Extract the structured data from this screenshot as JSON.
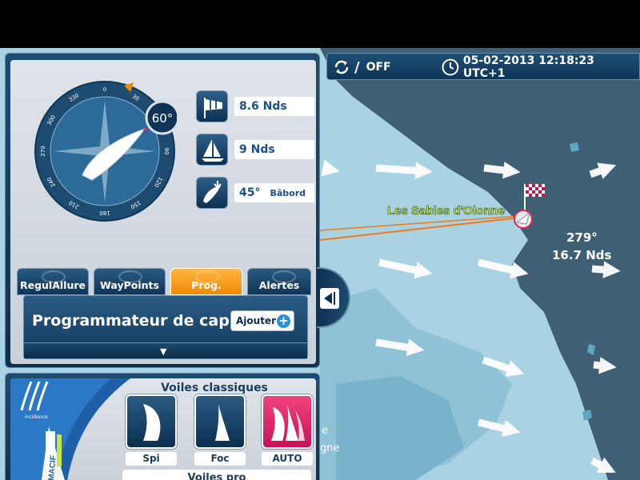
{
  "status": {
    "sync_state": "OFF",
    "datetime": "05-02-2013 12:18:23 UTC+1"
  },
  "map": {
    "port_label": "Les Sables d'Olonne",
    "current_direction": "279°",
    "current_speed": "16.7 Nds",
    "partial_label_1": "e",
    "partial_label_2": "gne"
  },
  "compass": {
    "heading_value": "60°",
    "ticks": [
      "0",
      "30",
      "60",
      "90",
      "120",
      "150",
      "180",
      "210",
      "240",
      "270",
      "300",
      "330"
    ]
  },
  "instruments": {
    "wind_speed": "8.6 Nds",
    "boat_speed": "9 Nds",
    "wind_angle": "45°",
    "wind_side": "Bâbord"
  },
  "tabs": [
    {
      "label": "RegulAllure",
      "active": false
    },
    {
      "label": "WayPoints",
      "active": false
    },
    {
      "label": "Prog.",
      "active": true
    },
    {
      "label": "Alertes",
      "active": false
    }
  ],
  "programmer": {
    "title": "Programmateur de cap",
    "add_label": "Ajouter"
  },
  "sails": {
    "title": "Voiles classiques",
    "items": [
      {
        "label": "Spi",
        "active": false
      },
      {
        "label": "Foc",
        "active": false
      },
      {
        "label": "AUTO",
        "active": true
      }
    ],
    "pro_label": "Voiles pro",
    "sponsor_name": "MACIF",
    "sponsor_sub": "incidence"
  },
  "colors": {
    "panel_dark": "#0d3050",
    "accent_orange": "#f08a00",
    "accent_pink": "#e0245e",
    "sea": "#a9d3e3",
    "land": "#3f5f75",
    "route": "#f07a1a"
  }
}
